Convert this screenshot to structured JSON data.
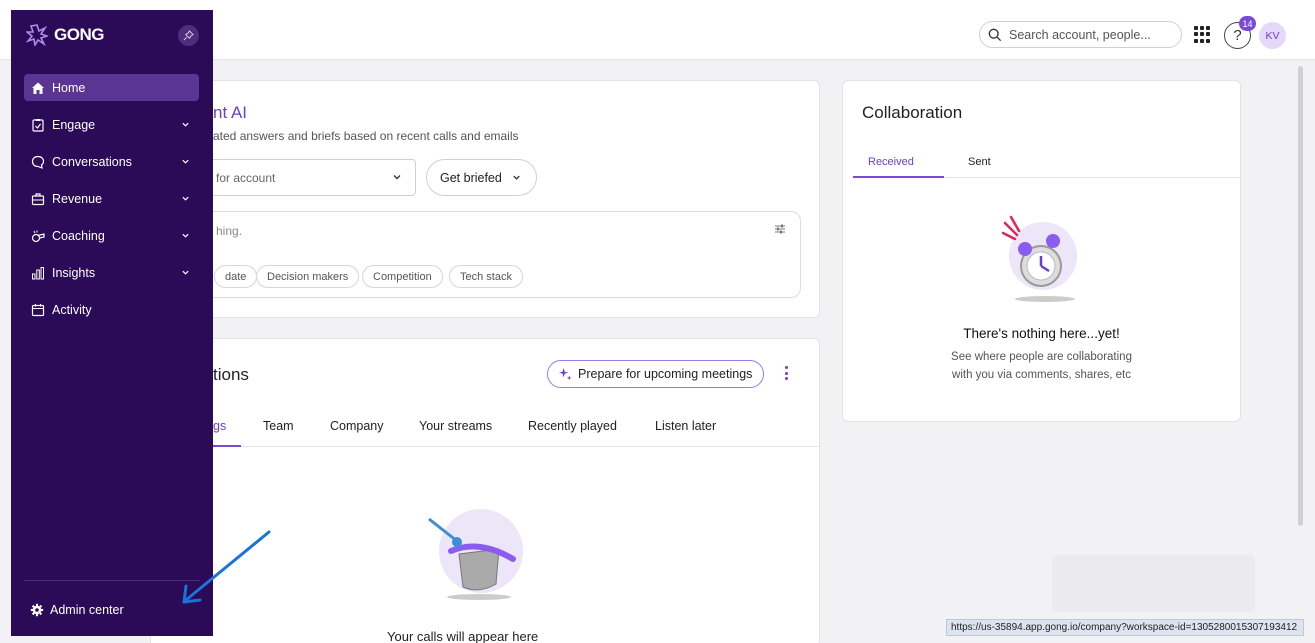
{
  "app": {
    "logo_text": "GONG"
  },
  "topbar": {
    "search_placeholder": "Search account, people...",
    "help_label": "?",
    "help_badge": "14",
    "avatar_initials": "KV"
  },
  "sidebar": {
    "items": [
      {
        "label": "Home",
        "icon": "home-icon",
        "active": true,
        "has_caret": false
      },
      {
        "label": "Engage",
        "icon": "clipboard-icon",
        "active": false,
        "has_caret": true
      },
      {
        "label": "Conversations",
        "icon": "chat-icon",
        "active": false,
        "has_caret": true
      },
      {
        "label": "Revenue",
        "icon": "briefcase-icon",
        "active": false,
        "has_caret": true
      },
      {
        "label": "Coaching",
        "icon": "whistle-icon",
        "active": false,
        "has_caret": true
      },
      {
        "label": "Insights",
        "icon": "bar-chart-icon",
        "active": false,
        "has_caret": true
      },
      {
        "label": "Activity",
        "icon": "calendar-icon",
        "active": false,
        "has_caret": false
      }
    ],
    "admin_label": "Admin center"
  },
  "ai_card": {
    "title": "nt AI",
    "subtitle": "ated answers and briefs based on recent calls and emails",
    "account_select": "for account",
    "briefed_button": "Get briefed",
    "ask_placeholder": "hing.",
    "chips": [
      "date",
      "Decision makers",
      "Competition",
      "Tech stack"
    ]
  },
  "calls_card": {
    "title": "tions",
    "prepare_button": "Prepare for upcoming meetings",
    "tabs": [
      "gs",
      "Team",
      "Company",
      "Your streams",
      "Recently played",
      "Listen later"
    ],
    "empty_text": "Your calls will appear here"
  },
  "collab_card": {
    "title": "Collaboration",
    "tabs": [
      "Received",
      "Sent"
    ],
    "empty_title": "There's nothing here...yet!",
    "empty_sub_1": "See where people are collaborating",
    "empty_sub_2": "with you via comments, shares, etc"
  },
  "status_url": "https://us-35894.app.gong.io/company?workspace-id=1305280015307193412",
  "colors": {
    "sidebar": "#2b0a57",
    "accent": "#6b3fc7",
    "active_nav": "#5a3591",
    "annotation_arrow": "#1a73d9"
  }
}
